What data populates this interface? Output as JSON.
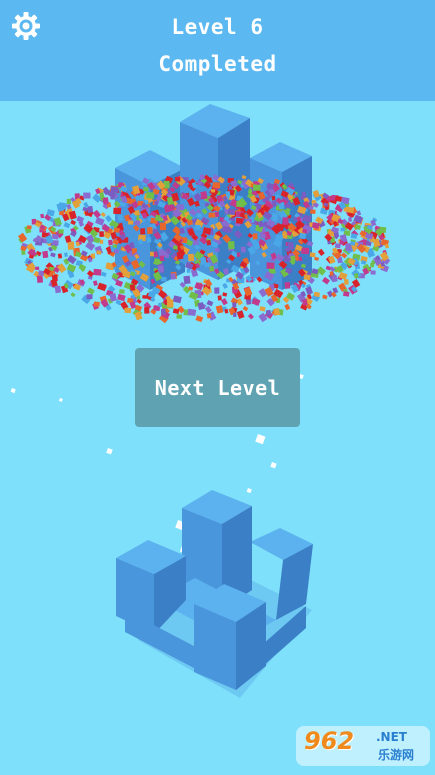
{
  "header": {
    "level_title": "Level 6",
    "status": "Completed",
    "settings_icon": "gear-icon",
    "background": "#5bb8f0"
  },
  "game": {
    "background": "#7ee0fb",
    "block_top": "#5cb2ee",
    "block_left": "#4a96dc",
    "block_right": "#3b7fc6",
    "confetti_colors": [
      "#d8232a",
      "#7b5cc0",
      "#e3a03a",
      "#4aa8e8",
      "#6fbf4a",
      "#c23a8c",
      "#8a6bd0",
      "#e8672c"
    ]
  },
  "next_button": {
    "label": "Next Level",
    "background": "#5fa3b3"
  },
  "watermark": {
    "big": "962",
    "net": ".NET",
    "cn": "乐游网"
  }
}
